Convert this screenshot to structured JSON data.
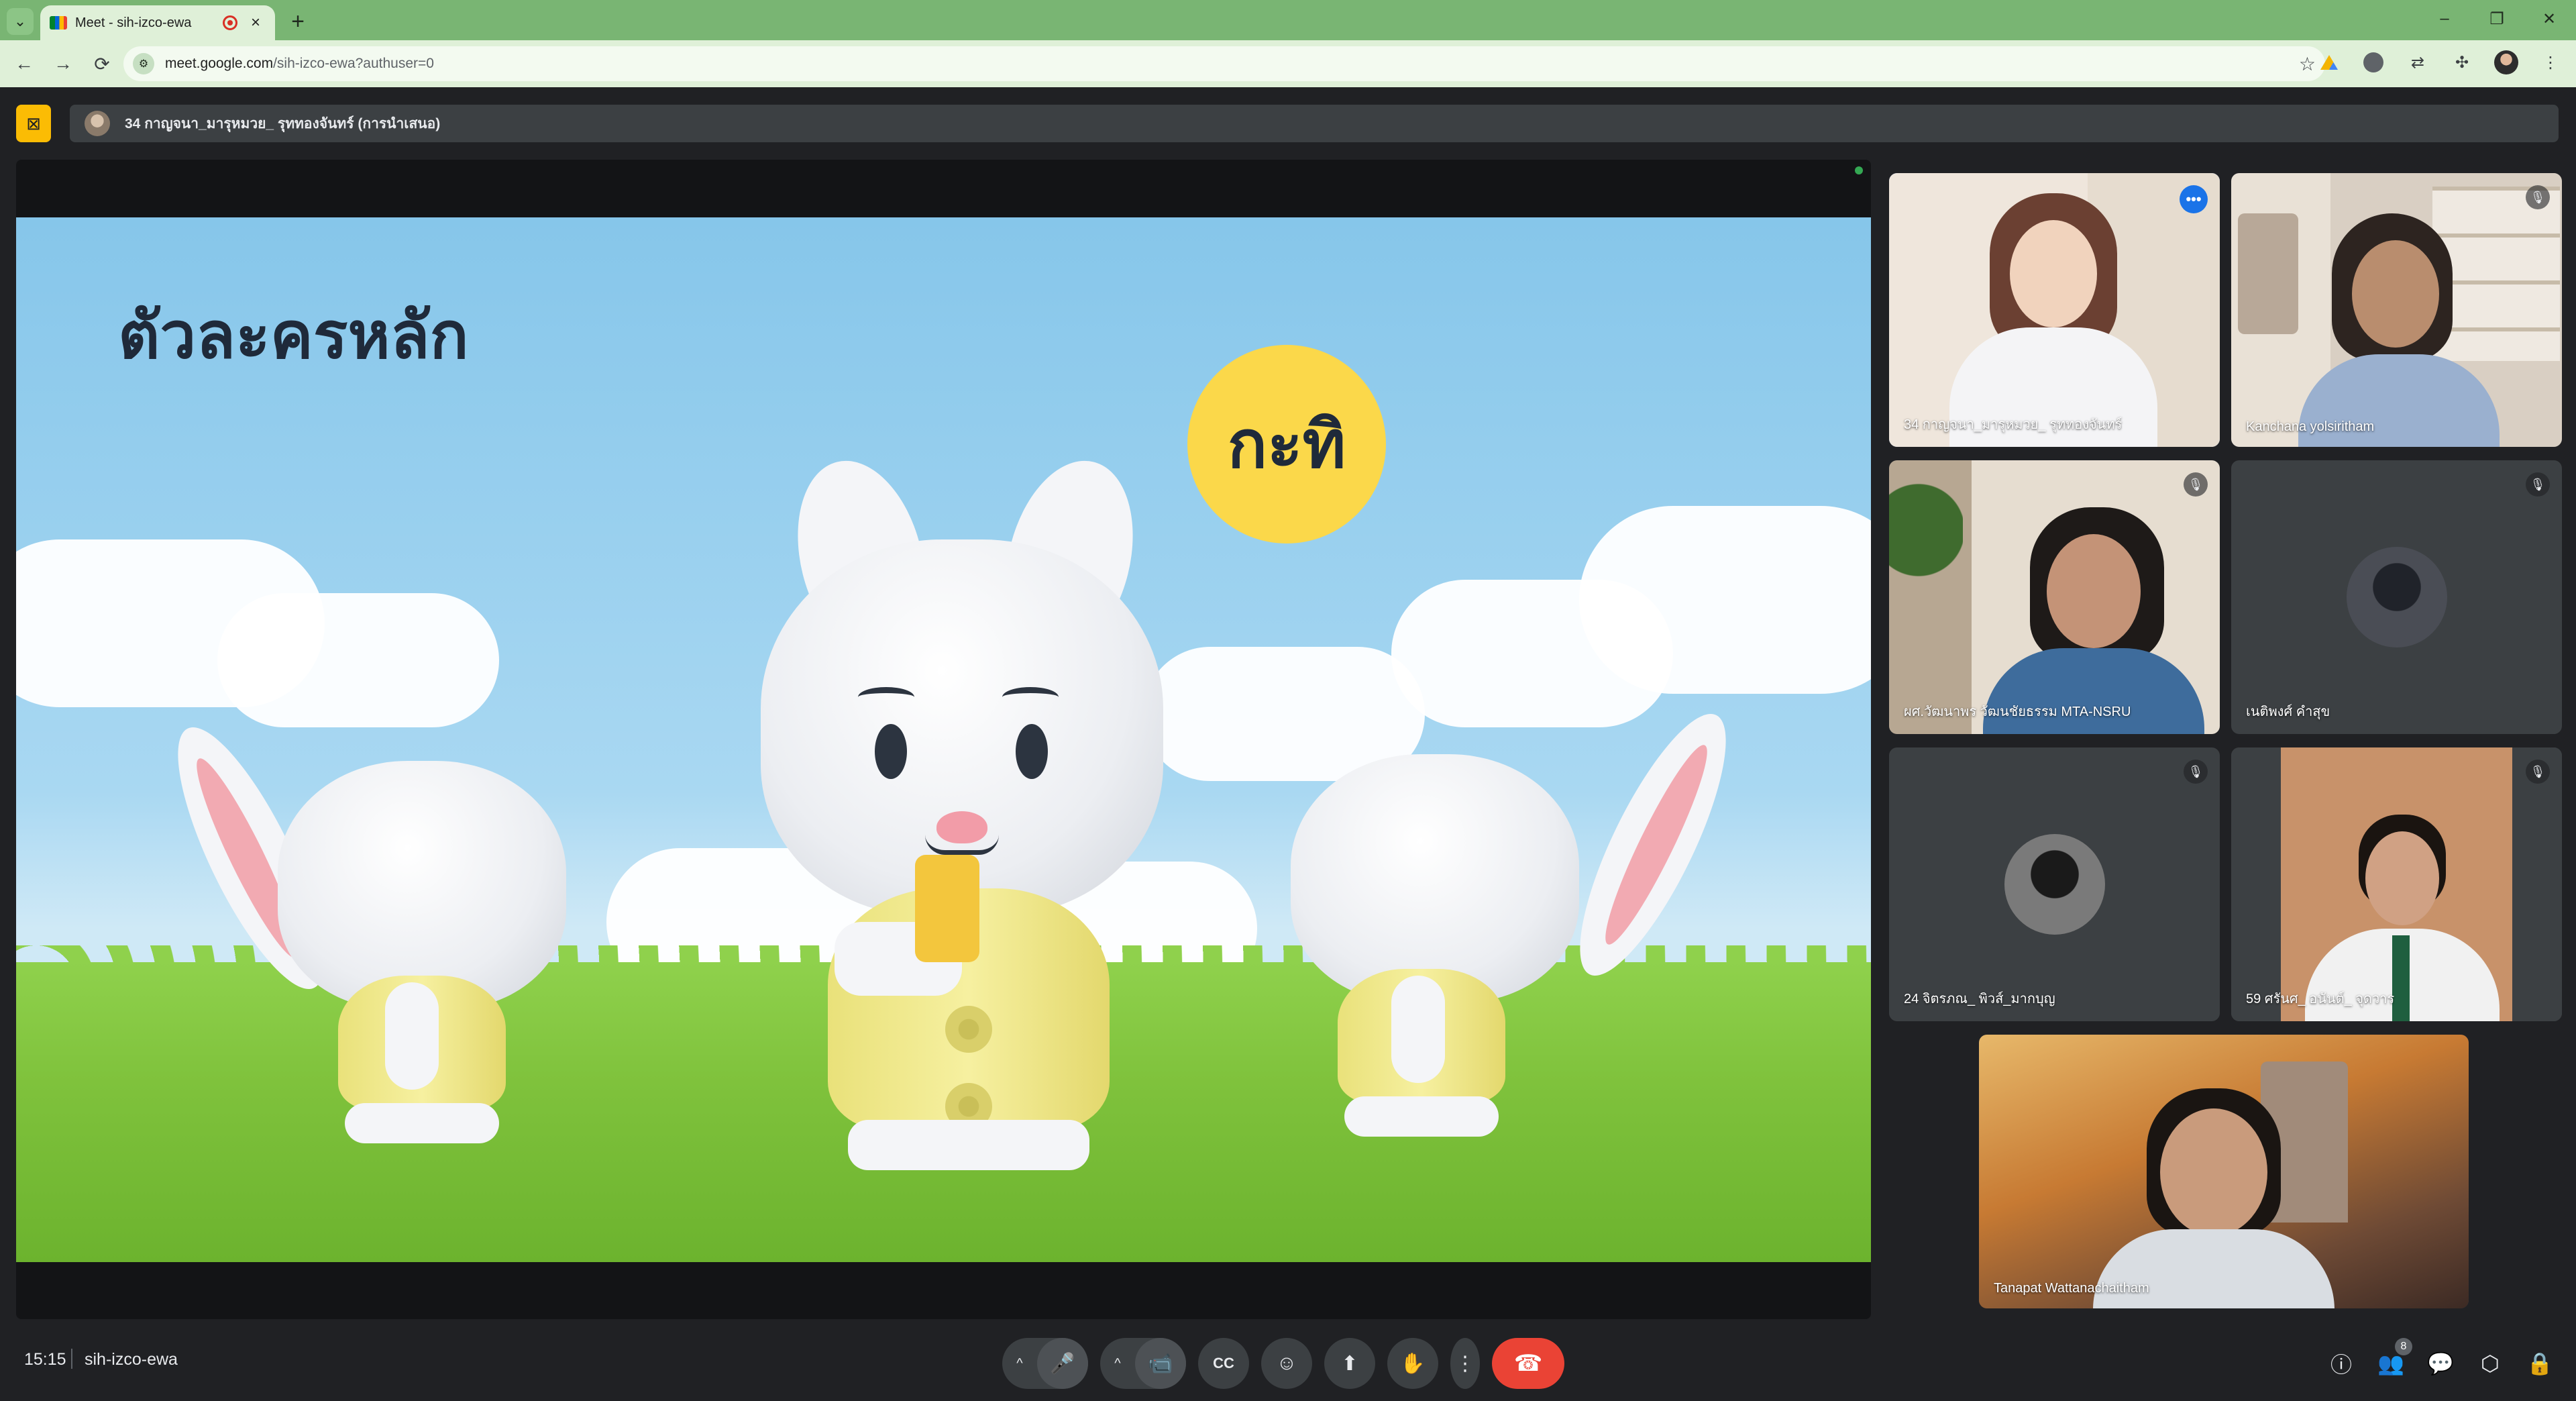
{
  "browser": {
    "tab_title": "Meet - sih-izco-ewa",
    "url_host": "meet.google.com",
    "url_path": "/sih-izco-ewa?authuser=0",
    "new_tab_glyph": "+",
    "tab_close_glyph": "×",
    "tab_menu_glyph": "⌄",
    "window_controls": {
      "minimize": "–",
      "restore": "❐",
      "close": "✕"
    },
    "nav": {
      "back": "←",
      "forward": "→",
      "reload": "⟳"
    },
    "star_glyph": "☆",
    "icons": [
      "google-drive-icon",
      "extension-icon",
      "translate-icon",
      "puzzle-icon",
      "profile-icon",
      "kebab-menu-icon"
    ]
  },
  "presentation": {
    "presenter_label": "34 กาญจนา_มารุหมวย_ รุททองจันทร์ (การนำเสนอ)",
    "stop_icon": "stop-presenting-icon",
    "slide": {
      "title": "ตัวละครหลัก",
      "character_name": "กะทิ"
    }
  },
  "participants": [
    {
      "name": "34 กาญจนา_มารุหมวย_ รุททองจันทร์",
      "muted": false,
      "speaking": true,
      "indicator": "•••"
    },
    {
      "name": "Kanchana yolsiritham",
      "muted": true,
      "speaking": false,
      "indicator": "🎙"
    },
    {
      "name": "ผศ.วัฒนาพร วัฒนชัยธรรม MTA-NSRU",
      "muted": true,
      "speaking": false,
      "indicator": "🎙"
    },
    {
      "name": "เนติพงศ์ คำสุข",
      "muted": true,
      "speaking": false,
      "indicator": "🎙"
    },
    {
      "name": "24 จิตรภณ_ พิวส์_มากบุญ",
      "muted": true,
      "speaking": false,
      "indicator": "🎙"
    },
    {
      "name": "59 ศรันศ_ อนันต์_ จุดวาร",
      "muted": true,
      "speaking": false,
      "indicator": "🎙"
    },
    {
      "name": "Tanapat Wattanachaitham",
      "muted": false,
      "speaking": false,
      "indicator": ""
    }
  ],
  "bottom_bar": {
    "time": "15:15",
    "meeting_code": "sih-izco-ewa",
    "participant_count": "8",
    "controls": {
      "mic": "🎤",
      "camera": "📹",
      "captions": "CC",
      "emoji": "☺",
      "present": "⬆",
      "hand": "✋",
      "more": "⋮",
      "end": "☎",
      "arrow": "^"
    },
    "right": {
      "info": "ⓘ",
      "people": "👥",
      "chat": "💬",
      "activities": "⬡",
      "host": "🔒"
    }
  }
}
